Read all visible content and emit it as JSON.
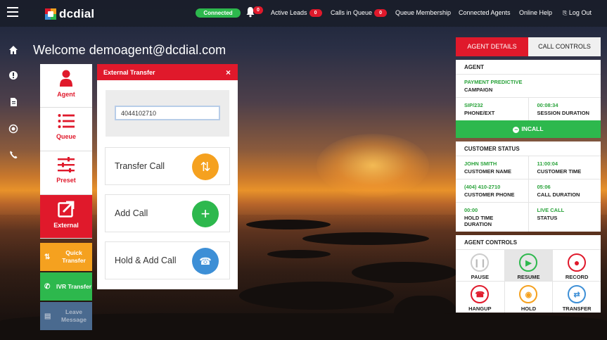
{
  "header": {
    "brand": "dcdial",
    "status": "Connected",
    "notifications": "0",
    "nav": [
      {
        "label": "Active Leads",
        "badge": "0"
      },
      {
        "label": "Calls in Queue",
        "badge": "0"
      },
      {
        "label": "Queue Membership",
        "badge": ""
      },
      {
        "label": "Connected Agents",
        "badge": ""
      },
      {
        "label": "Online Help",
        "badge": ""
      },
      {
        "label": "Log Out",
        "badge": ""
      }
    ]
  },
  "rail": [
    "home-icon",
    "alert-icon",
    "document-icon",
    "target-icon",
    "phone-icon"
  ],
  "welcome": "Welcome demoagent@dcdial.com",
  "menu": {
    "agent": "Agent",
    "queue": "Queue",
    "preset": "Preset",
    "external": "External",
    "quick_transfer": "Quick Transfer",
    "ivr_transfer": "IVR Transfer",
    "leave_message": "Leave Message"
  },
  "external_transfer": {
    "title": "External Transfer",
    "close": "×",
    "number": "4044102710",
    "buttons": {
      "transfer": "Transfer Call",
      "add": "Add Call",
      "hold_add": "Hold & Add Call"
    }
  },
  "right_panel": {
    "tabs": {
      "agent_details": "AGENT DETAILS",
      "call_controls": "CALL CONTROLS"
    },
    "agent": {
      "title": "AGENT",
      "campaign_value": "PAYMENT PREDICTIVE",
      "campaign_label": "CAMPAIGN",
      "phone_value": "SIP/232",
      "phone_label": "PHONE/EXT",
      "session_value": "00:08:34",
      "session_label": "SESSION DURATION",
      "incall": "INCALL"
    },
    "customer": {
      "title": "CUSTOMER STATUS",
      "name_value": "JOHN SMITH",
      "name_label": "CUSTOMER NAME",
      "time_value": "11:00:04",
      "time_label": "CUSTOMER TIME",
      "phone_value": "(404) 410-2710",
      "phone_label": "CUSTOMER PHONE",
      "duration_value": "05:06",
      "duration_label": "CALL DURATION",
      "hold_value": "00:00",
      "hold_label": "HOLD TIME DURATION",
      "status_value": "LIVE CALL",
      "status_label": "STATUS"
    },
    "controls": {
      "title": "AGENT CONTROLS",
      "pause": "PAUSE",
      "resume": "RESUME",
      "record": "RECORD",
      "hangup": "HANGUP",
      "hold": "HOLD",
      "transfer": "TRANSFER"
    }
  },
  "colors": {
    "brand_red": "#e0192b",
    "green": "#2db84d",
    "orange": "#f5a11f",
    "blue": "#3d8fd6",
    "muted_blue": "#4a6a8f"
  }
}
